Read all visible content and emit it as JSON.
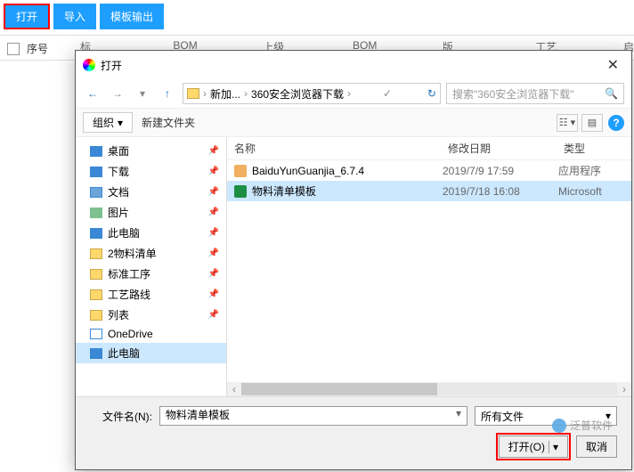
{
  "toolbar": {
    "open": "打开",
    "import": "导入",
    "export": "模板输出"
  },
  "grid": {
    "seq": "序号",
    "cols": [
      "标识",
      "BOM编号",
      "上级BOM",
      "BOM类型",
      "版本",
      "工艺路线",
      "启"
    ]
  },
  "dialog": {
    "title": "打开",
    "crumbs": {
      "a": "新加...",
      "b": "360安全浏览器下载"
    },
    "search_placeholder": "搜索\"360安全浏览器下载\"",
    "organize": "组织",
    "new_folder": "新建文件夹",
    "list_head": {
      "name": "名称",
      "date": "修改日期",
      "type": "类型"
    },
    "files": [
      {
        "icon": "exe",
        "name": "BaiduYunGuanjia_6.7.4",
        "date": "2019/7/9 17:59",
        "type": "应用程序",
        "sel": false
      },
      {
        "icon": "xls",
        "name": "物料清单模板",
        "date": "2019/7/18 16:08",
        "type": "Microsoft",
        "sel": true
      }
    ],
    "tree": [
      {
        "icon": "desktop",
        "label": "桌面",
        "pin": true
      },
      {
        "icon": "download",
        "label": "下载",
        "pin": true
      },
      {
        "icon": "doc",
        "label": "文档",
        "pin": true
      },
      {
        "icon": "pic",
        "label": "图片",
        "pin": true
      },
      {
        "icon": "pc",
        "label": "此电脑",
        "pin": true
      },
      {
        "icon": "folder",
        "label": "2物料清单",
        "pin": true
      },
      {
        "icon": "folder",
        "label": "标准工序",
        "pin": true
      },
      {
        "icon": "folder",
        "label": "工艺路线",
        "pin": true
      },
      {
        "icon": "folder",
        "label": "列表",
        "pin": true
      },
      {
        "icon": "cloud",
        "label": "OneDrive",
        "pin": false
      },
      {
        "icon": "pc",
        "label": "此电脑",
        "pin": false,
        "sel": true
      }
    ],
    "filename_label": "文件名(N):",
    "filename_value": "物料清单模板",
    "filetype": "所有文件",
    "open_btn": "打开(O)",
    "cancel_btn": "取消"
  },
  "watermark": "泛普软件"
}
